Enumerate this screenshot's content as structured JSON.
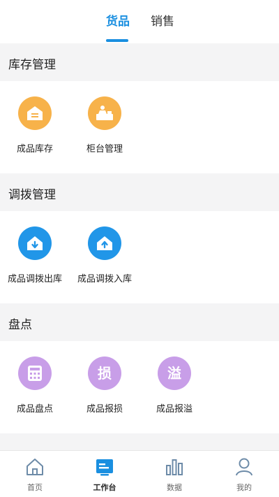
{
  "colors": {
    "accent": "#1a8fe0",
    "orange": "#f7b24a",
    "blue": "#2196e8",
    "purple": "#c89ee8",
    "section_bg": "#f4f4f5"
  },
  "top_tabs": [
    {
      "label": "货品",
      "active": true
    },
    {
      "label": "销售",
      "active": false
    }
  ],
  "sections": [
    {
      "title": "库存管理",
      "items": [
        {
          "label": "成品库存",
          "icon": "warehouse-icon"
        },
        {
          "label": "柜台管理",
          "icon": "counter-icon"
        }
      ]
    },
    {
      "title": "调拨管理",
      "items": [
        {
          "label": "成品调拨出库",
          "icon": "transfer-out-icon"
        },
        {
          "label": "成品调拨入库",
          "icon": "transfer-in-icon"
        }
      ]
    },
    {
      "title": "盘点",
      "items": [
        {
          "label": "成品盘点",
          "icon": "calculator-icon"
        },
        {
          "label": "成品报损",
          "icon": "loss-icon",
          "glyph": "损"
        },
        {
          "label": "成品报溢",
          "icon": "overflow-icon",
          "glyph": "溢"
        }
      ]
    }
  ],
  "bottom_nav": [
    {
      "label": "首页",
      "icon": "home-icon",
      "active": false
    },
    {
      "label": "工作台",
      "icon": "workbench-icon",
      "active": true
    },
    {
      "label": "数据",
      "icon": "bar-chart-icon",
      "active": false
    },
    {
      "label": "我的",
      "icon": "user-icon",
      "active": false
    }
  ]
}
